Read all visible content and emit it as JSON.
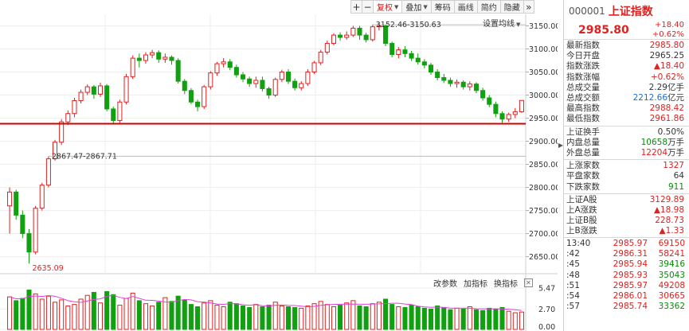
{
  "toolbar": {
    "items": [
      {
        "label": "+",
        "selected": false,
        "dropdown": false,
        "square": true
      },
      {
        "label": "−",
        "selected": false,
        "dropdown": false,
        "square": true
      },
      {
        "label": "复权",
        "selected": true,
        "dropdown": true,
        "square": false
      },
      {
        "label": "叠加",
        "selected": false,
        "dropdown": true,
        "square": false
      },
      {
        "label": "筹码",
        "selected": false,
        "dropdown": false,
        "square": false
      },
      {
        "label": "画线",
        "selected": false,
        "dropdown": false,
        "square": false
      },
      {
        "label": "简约",
        "selected": false,
        "dropdown": false,
        "square": false
      },
      {
        "label": "隐藏",
        "selected": false,
        "dropdown": false,
        "square": false
      },
      {
        "label": "»",
        "selected": false,
        "dropdown": false,
        "square": true
      }
    ]
  },
  "ma_setting_label": "设置均线",
  "vol_tools": {
    "change_params": "改参数",
    "add_indicator": "加指标",
    "switch_indicator": "换指标",
    "close": "✕"
  },
  "colors": {
    "up": "#e02020",
    "down": "#10a010",
    "ma": "#e040e0",
    "support_line": "#d00000"
  },
  "chart_data": {
    "type": "candlestick",
    "y_axis": {
      "min": 2620,
      "max": 3175,
      "ticks": [
        3150,
        3100,
        3050,
        3000,
        2950,
        2900,
        2850,
        2800,
        2750,
        2700,
        2650
      ]
    },
    "tick_labels": [
      "3150.00",
      "3100.00",
      "3050.00",
      "3000.00",
      "2950.00",
      "2900.00",
      "2850.00",
      "2800.00",
      "2750.00",
      "2700.00",
      "2650.00"
    ],
    "annotations": [
      {
        "text": "3152.46-3150.63",
        "value": 3152.46
      },
      {
        "text": "2867.47-2867.71",
        "value": 2867.47
      },
      {
        "text": "2635.09",
        "value": 2635.09
      }
    ],
    "support_level": 2938,
    "candles": [
      [
        2760,
        2790,
        2700,
        2800
      ],
      [
        2790,
        2740,
        2730,
        2795
      ],
      [
        2740,
        2700,
        2690,
        2750
      ],
      [
        2700,
        2660,
        2635.09,
        2710
      ],
      [
        2660,
        2755,
        2655,
        2760
      ],
      [
        2755,
        2805,
        2750,
        2810
      ],
      [
        2805,
        2862,
        2800,
        2867.47
      ],
      [
        2862,
        2898,
        2858,
        2903
      ],
      [
        2898,
        2942,
        2892,
        2948
      ],
      [
        2942,
        2960,
        2935,
        2967
      ],
      [
        2960,
        2988,
        2952,
        2994
      ],
      [
        2988,
        3006,
        2982,
        3012
      ],
      [
        3006,
        3018,
        3000,
        3023
      ],
      [
        3018,
        3002,
        2992,
        3022
      ],
      [
        3002,
        3020,
        2996,
        3027
      ],
      [
        3020,
        2970,
        2965,
        3024
      ],
      [
        2970,
        2945,
        2938,
        2975
      ],
      [
        2945,
        2985,
        2940,
        2990
      ],
      [
        2985,
        3040,
        2980,
        3046
      ],
      [
        3040,
        3080,
        3035,
        3086
      ],
      [
        3080,
        3075,
        3060,
        3090
      ],
      [
        3075,
        3087,
        3068,
        3093
      ],
      [
        3087,
        3092,
        3080,
        3098
      ],
      [
        3092,
        3078,
        3070,
        3097
      ],
      [
        3078,
        3082,
        3070,
        3090
      ],
      [
        3082,
        3075,
        3066,
        3086
      ],
      [
        3075,
        3030,
        3025,
        3080
      ],
      [
        3030,
        3010,
        3002,
        3035
      ],
      [
        3010,
        2985,
        2980,
        3015
      ],
      [
        2985,
        2975,
        2965,
        2990
      ],
      [
        2975,
        3018,
        2970,
        3022
      ],
      [
        3018,
        3048,
        3012,
        3052
      ],
      [
        3048,
        3068,
        3042,
        3072
      ],
      [
        3068,
        3072,
        3060,
        3080
      ],
      [
        3072,
        3060,
        3054,
        3078
      ],
      [
        3060,
        3044,
        3038,
        3066
      ],
      [
        3044,
        3035,
        3028,
        3050
      ],
      [
        3035,
        3025,
        3018,
        3040
      ],
      [
        3025,
        3032,
        3016,
        3040
      ],
      [
        3032,
        3014,
        3008,
        3040
      ],
      [
        3014,
        3000,
        2992,
        3018
      ],
      [
        3000,
        3034,
        2996,
        3038
      ],
      [
        3034,
        3050,
        3028,
        3055
      ],
      [
        3050,
        3030,
        3024,
        3056
      ],
      [
        3030,
        3016,
        3010,
        3036
      ],
      [
        3016,
        3025,
        3010,
        3030
      ],
      [
        3025,
        3050,
        3020,
        3056
      ],
      [
        3050,
        3070,
        3046,
        3074
      ],
      [
        3070,
        3093,
        3065,
        3098
      ],
      [
        3093,
        3112,
        3088,
        3118
      ],
      [
        3112,
        3130,
        3108,
        3134
      ],
      [
        3130,
        3125,
        3118,
        3136
      ],
      [
        3125,
        3130,
        3120,
        3138
      ],
      [
        3130,
        3145,
        3126,
        3150
      ],
      [
        3145,
        3130,
        3120,
        3150
      ],
      [
        3130,
        3120,
        3114,
        3135
      ],
      [
        3120,
        3148,
        3116,
        3152.46
      ],
      [
        3148,
        3150,
        3140,
        3157
      ],
      [
        3150,
        3112,
        3106,
        3152
      ],
      [
        3112,
        3088,
        3082,
        3116
      ],
      [
        3088,
        3098,
        3080,
        3104
      ],
      [
        3098,
        3090,
        3082,
        3106
      ],
      [
        3090,
        3080,
        3074,
        3096
      ],
      [
        3080,
        3072,
        3066,
        3090
      ],
      [
        3072,
        3065,
        3058,
        3078
      ],
      [
        3065,
        3050,
        3044,
        3070
      ],
      [
        3050,
        3038,
        3032,
        3056
      ],
      [
        3038,
        3032,
        3026,
        3046
      ],
      [
        3032,
        3025,
        3018,
        3038
      ],
      [
        3025,
        3028,
        3016,
        3034
      ],
      [
        3028,
        3018,
        3012,
        3032
      ],
      [
        3018,
        3024,
        3010,
        3030
      ],
      [
        3024,
        3010,
        3004,
        3028
      ],
      [
        3010,
        2994,
        2988,
        3016
      ],
      [
        2994,
        2980,
        2974,
        3000
      ],
      [
        2980,
        2960,
        2952,
        2986
      ],
      [
        2960,
        2948,
        2940,
        2965
      ],
      [
        2948,
        2958,
        2942,
        2962
      ],
      [
        2958,
        2964,
        2950,
        2972
      ],
      [
        2964,
        2988.42,
        2961.86,
        2988.42
      ]
    ],
    "volume_axis": {
      "min": 0,
      "max": 5.47,
      "tick_labels": [
        "5.47",
        "2.70",
        "0.00"
      ],
      "ticks": [
        5.47,
        2.7,
        0.0
      ]
    },
    "volumes": [
      4.3,
      3.8,
      4.1,
      5.2,
      4.7,
      4.0,
      4.4,
      3.6,
      3.9,
      3.1,
      3.3,
      4.0,
      4.5,
      4.9,
      3.5,
      5.0,
      4.6,
      3.2,
      4.1,
      4.8,
      3.8,
      3.4,
      3.1,
      3.6,
      4.2,
      3.7,
      4.4,
      3.9,
      3.3,
      3.0,
      3.5,
      3.8,
      3.2,
      3.0,
      3.6,
      3.4,
      3.1,
      2.9,
      3.3,
      3.0,
      3.2,
      3.6,
      3.1,
      3.0,
      2.9,
      2.8,
      3.1,
      3.4,
      3.7,
      3.3,
      3.0,
      3.2,
      3.5,
      3.8,
      3.1,
      3.0,
      3.4,
      3.6,
      4.0,
      3.3,
      3.0,
      2.9,
      3.2,
      3.0,
      2.8,
      2.7,
      3.1,
      2.9,
      2.6,
      2.8,
      2.7,
      3.0,
      2.6,
      2.5,
      2.8,
      2.7,
      2.9,
      2.4,
      2.2,
      2.3
    ]
  },
  "panel": {
    "code": "000001",
    "name": "上证指数",
    "price": "2985.80",
    "change": "+18.40",
    "change_pct": "+0.62%",
    "sections": [
      [
        {
          "label": "最新指数",
          "value": "2985.80",
          "cls": "red",
          "unit": ""
        },
        {
          "label": "今日开盘",
          "value": "2965.25",
          "cls": "",
          "unit": ""
        },
        {
          "label": "指数涨跌",
          "value": "▲18.40",
          "cls": "red",
          "unit": ""
        },
        {
          "label": "指数涨幅",
          "value": "+0.62%",
          "cls": "red",
          "unit": ""
        },
        {
          "label": "总成交量",
          "value": "2.29",
          "cls": "",
          "unit": "亿手"
        },
        {
          "label": "总成交额",
          "value": "2212.66",
          "cls": "blue",
          "unit": "亿元"
        },
        {
          "label": "最高指数",
          "value": "2988.42",
          "cls": "red",
          "unit": ""
        },
        {
          "label": "最低指数",
          "value": "2961.86",
          "cls": "red",
          "unit": ""
        }
      ],
      [
        {
          "label": "上证换手",
          "value": "0.50%",
          "cls": "",
          "unit": ""
        },
        {
          "label": "内盘总量",
          "value": "10658",
          "cls": "green",
          "unit": "万手"
        },
        {
          "label": "外盘总量",
          "value": "12204",
          "cls": "red",
          "unit": "万手"
        }
      ],
      [
        {
          "label": "上涨家数",
          "value": "1327",
          "cls": "red",
          "unit": ""
        },
        {
          "label": "平盘家数",
          "value": "64",
          "cls": "",
          "unit": ""
        },
        {
          "label": "下跌家数",
          "value": "911",
          "cls": "green",
          "unit": ""
        }
      ],
      [
        {
          "label": "上证A股",
          "value": "3129.89",
          "cls": "red",
          "unit": ""
        },
        {
          "label": "上A涨跌",
          "value": "▲18.98",
          "cls": "red",
          "unit": ""
        },
        {
          "label": "上证B股",
          "value": "228.73",
          "cls": "red",
          "unit": ""
        },
        {
          "label": "上B涨跌",
          "value": "▲1.33",
          "cls": "red",
          "unit": ""
        }
      ]
    ],
    "ticks": [
      {
        "time": "13:40",
        "price": "2985.97",
        "vol": "69150",
        "pcls": "red",
        "vcls": "red"
      },
      {
        "time": ":42",
        "price": "2986.31",
        "vol": "58241",
        "pcls": "red",
        "vcls": "red"
      },
      {
        "time": ":45",
        "price": "2985.94",
        "vol": "39416",
        "pcls": "red",
        "vcls": "green"
      },
      {
        "time": ":48",
        "price": "2985.93",
        "vol": "35043",
        "pcls": "red",
        "vcls": "green"
      },
      {
        "time": ":51",
        "price": "2985.97",
        "vol": "49208",
        "pcls": "red",
        "vcls": "red"
      },
      {
        "time": ":54",
        "price": "2986.01",
        "vol": "30665",
        "pcls": "red",
        "vcls": "red"
      },
      {
        "time": ":57",
        "price": "2985.74",
        "vol": "33362",
        "pcls": "red",
        "vcls": "green"
      }
    ]
  }
}
